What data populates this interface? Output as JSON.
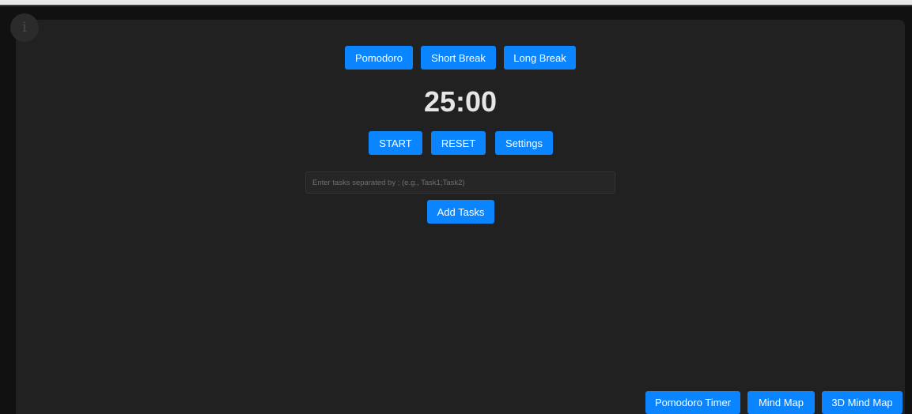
{
  "info": {
    "glyph": "i"
  },
  "modes": {
    "pomodoro": "Pomodoro",
    "short_break": "Short Break",
    "long_break": "Long Break"
  },
  "timer": {
    "display": "25:00"
  },
  "controls": {
    "start": "START",
    "reset": "RESET",
    "settings": "Settings"
  },
  "tasks": {
    "placeholder": "Enter tasks separated by ; (e.g., Task1;Task2)",
    "value": "",
    "add_label": "Add Tasks"
  },
  "nav": {
    "pomodoro_timer": "Pomodoro Timer",
    "mind_map": "Mind Map",
    "mind_map_3d": "3D Mind Map"
  },
  "colors": {
    "accent": "#0a84ff",
    "panel": "#212121",
    "background": "#111111",
    "text": "#e6e6e6"
  },
  "icons": {
    "info": "info-icon"
  }
}
